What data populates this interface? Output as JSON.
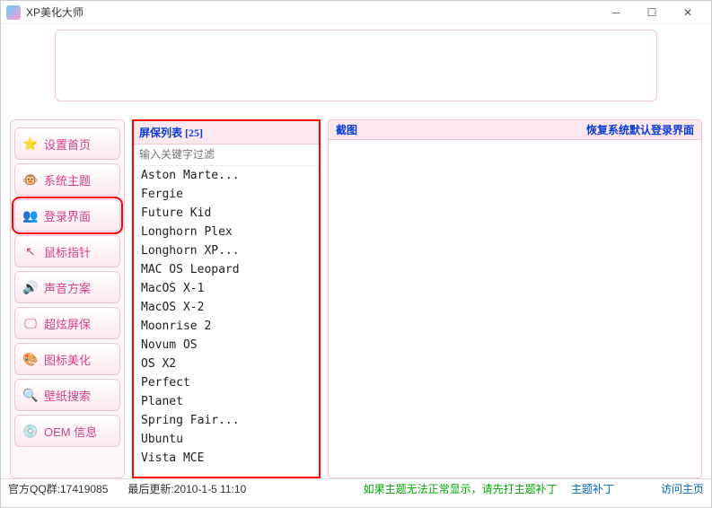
{
  "window": {
    "title": "XP美化大师"
  },
  "sidebar": {
    "items": [
      {
        "label": "设置首页",
        "icon": "⭐",
        "icon_name": "star-icon"
      },
      {
        "label": "系统主题",
        "icon": "🐵",
        "icon_name": "monkey-icon"
      },
      {
        "label": "登录界面",
        "icon": "👥",
        "icon_name": "users-icon"
      },
      {
        "label": "鼠标指针",
        "icon": "↖",
        "icon_name": "cursor-icon"
      },
      {
        "label": "声音方案",
        "icon": "🔊",
        "icon_name": "speaker-icon"
      },
      {
        "label": "超炫屏保",
        "icon": "🖵",
        "icon_name": "monitor-icon"
      },
      {
        "label": "图标美化",
        "icon": "🎨",
        "icon_name": "palette-icon"
      },
      {
        "label": "壁纸搜索",
        "icon": "🔍",
        "icon_name": "search-icon"
      },
      {
        "label": "OEM 信息",
        "icon": "💿",
        "icon_name": "disc-icon"
      }
    ],
    "active_index": 2
  },
  "list": {
    "header": "屏保列表 [25]",
    "filter_placeholder": "输入关键字过滤",
    "items": [
      "Aston Marte...",
      "Fergie",
      "Future Kid",
      "Longhorn Plex",
      "Longhorn XP...",
      "MAC OS Leopard",
      "MacOS X-1",
      "MacOS X-2",
      "Moonrise 2",
      "Novum OS",
      "OS X2",
      "Perfect",
      "Planet",
      "Spring Fair...",
      "Ubuntu",
      "Vista MCE"
    ]
  },
  "preview": {
    "title": "截图",
    "reset_link": "恢复系统默认登录界面"
  },
  "statusbar": {
    "qq": "官方QQ群:17419085",
    "updated": "最后更新:2010-1-5 11:10",
    "warning": "如果主题无法正常显示，请先打主题补丁",
    "patch_link": "主题补丁",
    "home_link": "访问主页"
  }
}
